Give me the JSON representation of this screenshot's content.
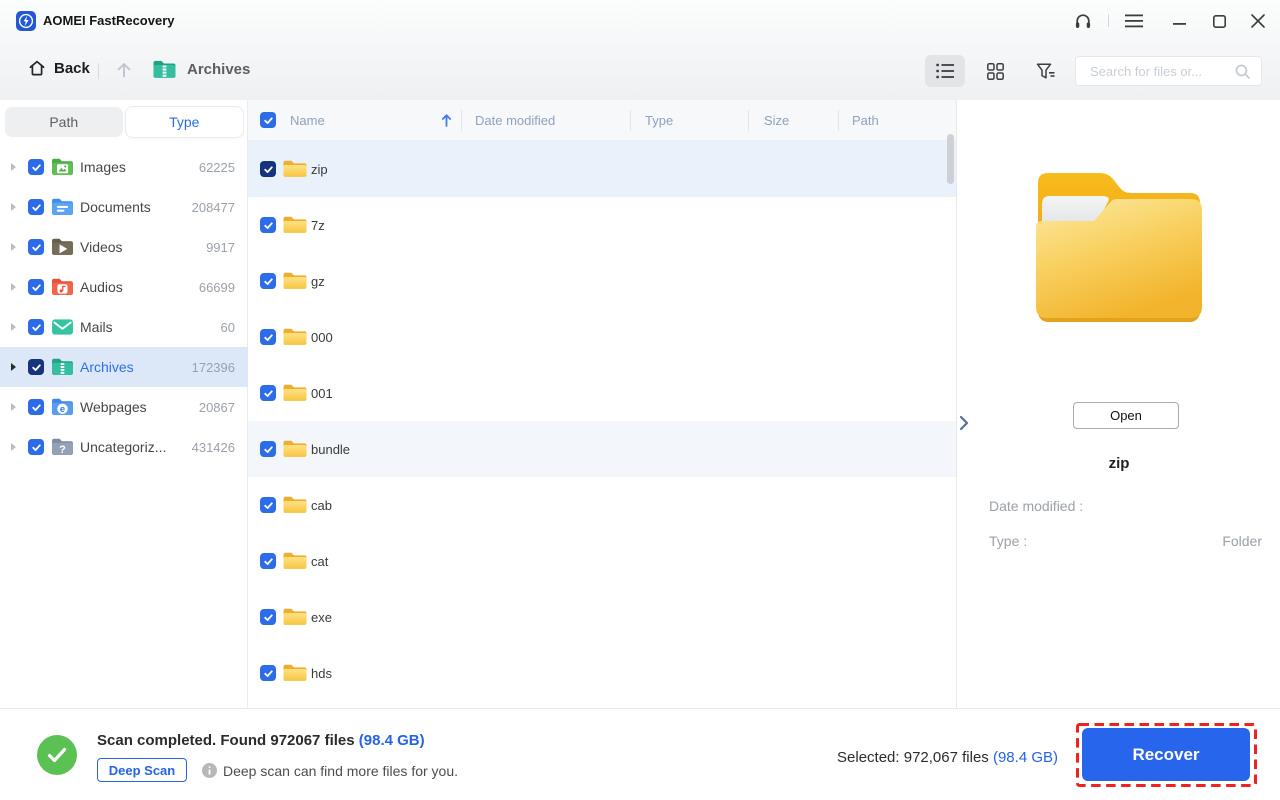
{
  "window": {
    "title": "AOMEI FastRecovery"
  },
  "toolbar": {
    "back": "Back",
    "breadcrumb": "Archives",
    "search_placeholder": "Search for files or..."
  },
  "sidebar": {
    "tabs": [
      {
        "label": "Path"
      },
      {
        "label": "Type"
      }
    ],
    "active_tab": "Type",
    "items": [
      {
        "label": "Images",
        "count": "62225",
        "icon": "images-folder-icon"
      },
      {
        "label": "Documents",
        "count": "208477",
        "icon": "documents-folder-icon"
      },
      {
        "label": "Videos",
        "count": "9917",
        "icon": "videos-folder-icon"
      },
      {
        "label": "Audios",
        "count": "66699",
        "icon": "audios-folder-icon"
      },
      {
        "label": "Mails",
        "count": "60",
        "icon": "mails-icon"
      },
      {
        "label": "Archives",
        "count": "172396",
        "icon": "archives-folder-icon",
        "selected": true
      },
      {
        "label": "Webpages",
        "count": "20867",
        "icon": "webpages-folder-icon"
      },
      {
        "label": "Uncategoriz...",
        "count": "431426",
        "icon": "uncategorized-folder-icon"
      }
    ]
  },
  "filelist": {
    "columns": [
      "Name",
      "Date modified",
      "Type",
      "Size",
      "Path"
    ],
    "sort_column": "Name",
    "sort_direction": "ascending",
    "rows": [
      {
        "name": "zip",
        "state": "selected"
      },
      {
        "name": "7z",
        "state": ""
      },
      {
        "name": "gz",
        "state": ""
      },
      {
        "name": "000",
        "state": ""
      },
      {
        "name": "001",
        "state": ""
      },
      {
        "name": "bundle",
        "state": "highlighted"
      },
      {
        "name": "cab",
        "state": ""
      },
      {
        "name": "cat",
        "state": ""
      },
      {
        "name": "exe",
        "state": ""
      },
      {
        "name": "hds",
        "state": ""
      }
    ]
  },
  "preview": {
    "open_button": "Open",
    "file_name": "zip",
    "fields": [
      {
        "label": "Date modified :",
        "value": ""
      },
      {
        "label": "Type :",
        "value": "Folder"
      }
    ]
  },
  "statusbar": {
    "scan_message": "Scan completed. Found 972067 files",
    "scan_size": "(98.4 GB)",
    "deep_scan_button": "Deep Scan",
    "deep_scan_hint": "Deep scan can find more files for you.",
    "selected_label": "Selected: 972,067 files",
    "selected_size": "(98.4 GB)",
    "recover_button": "Recover"
  },
  "colors": {
    "accent": "#2563eb",
    "checkbox_blue": "#2d6ce8",
    "checkbox_dark": "#16347e",
    "success_green": "#5ac152",
    "annotation_red": "#ee2222",
    "selected_row": "#e9f1fb",
    "hover_row": "#f3f7fc",
    "sidebar_selected_row": "#dce8f8"
  }
}
